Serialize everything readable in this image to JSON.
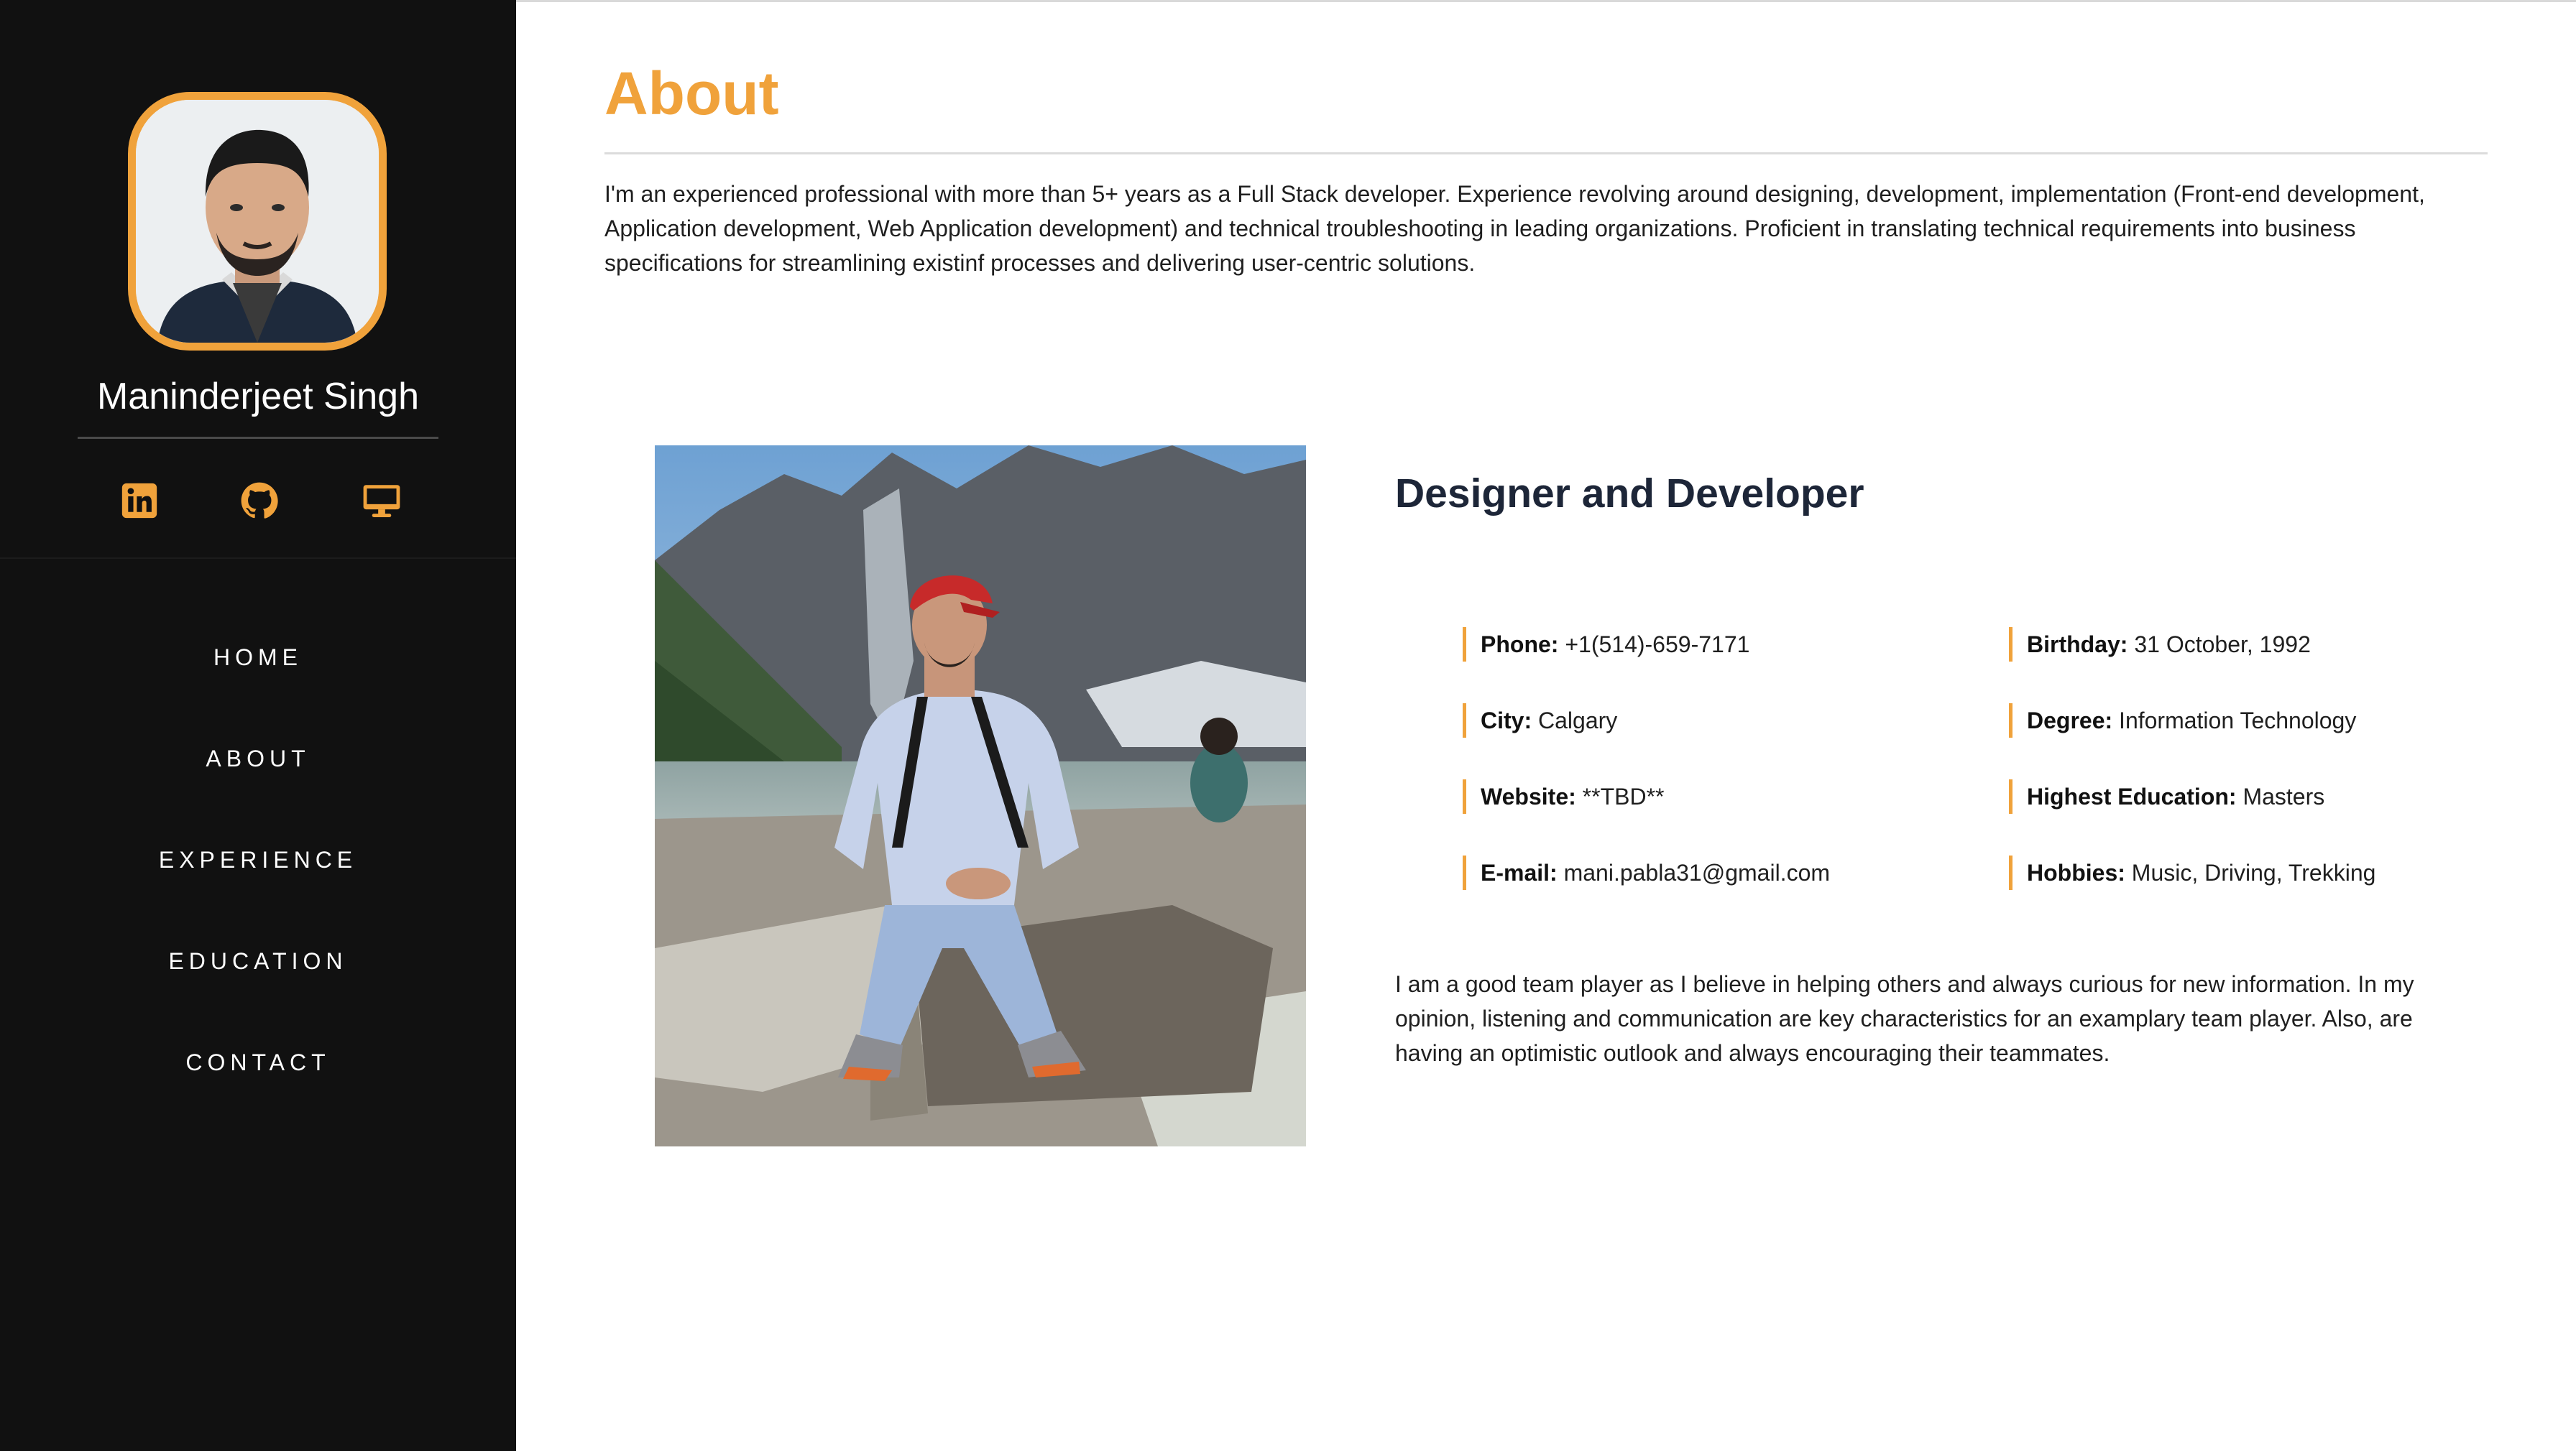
{
  "sidebar": {
    "name": "Maninderjeet Singh",
    "socials": [
      {
        "icon": "linkedin-icon"
      },
      {
        "icon": "github-icon"
      },
      {
        "icon": "desktop-icon"
      }
    ],
    "nav": [
      "HOME",
      "ABOUT",
      "EXPERIENCE",
      "EDUCATION",
      "CONTACT"
    ]
  },
  "main": {
    "title": "About",
    "intro": "I'm an experienced professional with more than 5+ years as a Full Stack developer. Experience revolving around designing, development, implementation (Front-end development, Application development, Web Application development) and technical troubleshooting in leading organizations. Proficient in translating technical requirements into business specifications for streamlining existinf processes and delivering user-centric solutions.",
    "subtitle": "Designer and Developer",
    "info_left": [
      {
        "label": "Phone:",
        "value": "+1(514)-659-7171"
      },
      {
        "label": "City:",
        "value": "Calgary"
      },
      {
        "label": "Website:",
        "value": "**TBD**"
      },
      {
        "label": "E-mail:",
        "value": "mani.pabla31@gmail.com"
      }
    ],
    "info_right": [
      {
        "label": "Birthday:",
        "value": "31 October, 1992"
      },
      {
        "label": "Degree:",
        "value": "Information Technology"
      },
      {
        "label": "Highest Education:",
        "value": "Masters"
      },
      {
        "label": "Hobbies:",
        "value": "Music, Driving, Trekking"
      }
    ],
    "bottom_text": "I am a good team player as I believe in helping others and always curious for new information. In my opinion, listening and communication are key characteristics for an examplary team player. Also, are having an optimistic outlook and always encouraging their teammates."
  },
  "colors": {
    "accent": "#f0a23b",
    "sidebar_bg": "#111111",
    "heading_dark": "#1d2638"
  }
}
